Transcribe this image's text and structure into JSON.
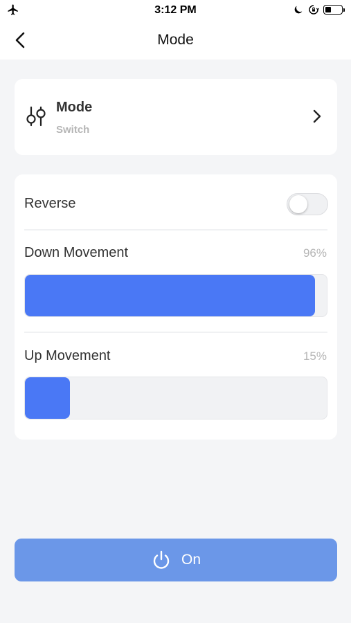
{
  "status_bar": {
    "time": "3:12 PM",
    "icons": [
      "airplane-icon",
      "moon-icon",
      "orientation-lock-icon",
      "battery-icon"
    ]
  },
  "nav": {
    "title": "Mode",
    "back_icon": "chevron-left-icon"
  },
  "mode_card": {
    "title": "Mode",
    "subtitle": "Switch",
    "icon": "sliders-icon",
    "chevron_icon": "chevron-right-icon"
  },
  "settings": {
    "reverse": {
      "label": "Reverse",
      "enabled": false
    },
    "down_movement": {
      "label": "Down Movement",
      "value_text": "96%",
      "value": 0.96
    },
    "up_movement": {
      "label": "Up Movement",
      "value_text": "15%",
      "value": 0.15
    }
  },
  "power_button": {
    "label": "On",
    "icon": "power-icon"
  },
  "colors": {
    "accent": "#4a78f5",
    "button": "#6b97e8",
    "background": "#f4f5f7"
  }
}
